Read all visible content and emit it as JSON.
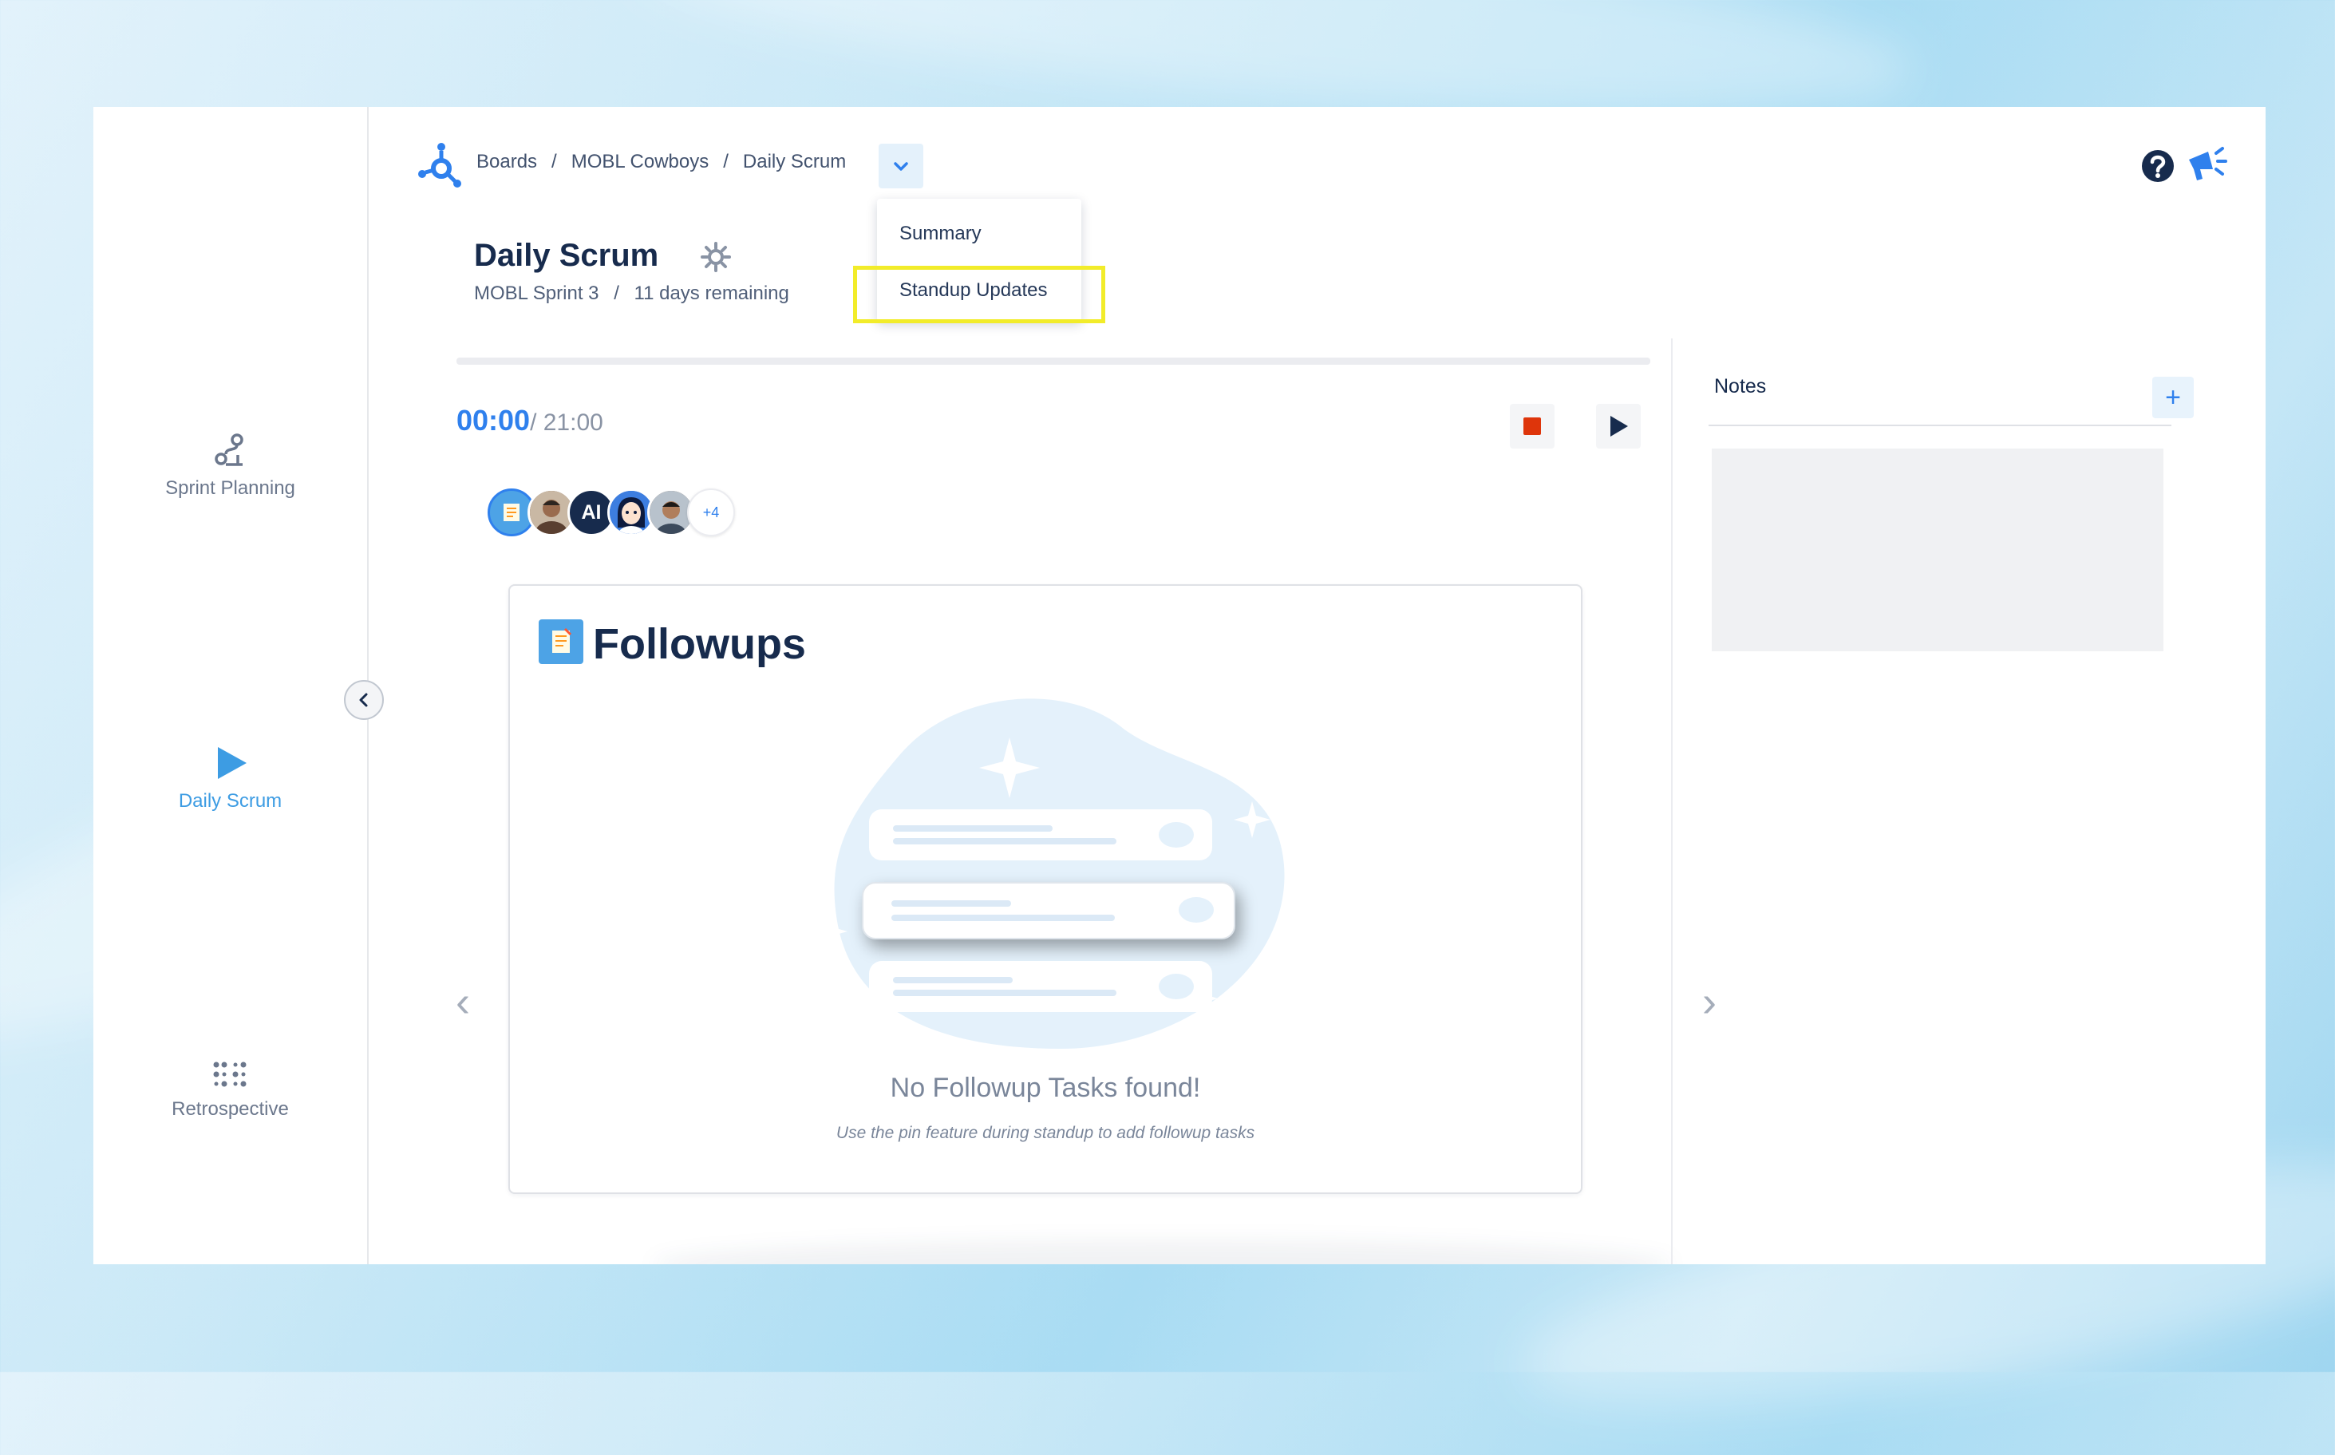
{
  "sidebar": {
    "items": [
      {
        "label": "Sprint Planning",
        "icon": "sprint-planning-icon"
      },
      {
        "label": "Daily Scrum",
        "icon": "play-icon",
        "active": true
      },
      {
        "label": "Retrospective",
        "icon": "retrospective-icon"
      }
    ]
  },
  "header": {
    "breadcrumbs": [
      "Boards",
      "MOBL Cowboys",
      "Daily Scrum"
    ],
    "separator": "/",
    "dropdown_items": [
      "Summary",
      "Standup Updates"
    ],
    "highlighted_item": "Standup Updates"
  },
  "page": {
    "title": "Daily Scrum",
    "sprint": "MOBL Sprint 3",
    "subtitle_separator": "/",
    "remaining": "11 days remaining"
  },
  "timer": {
    "current": "00:00",
    "total": "/ 21:00"
  },
  "avatars": {
    "initials_avatar": "AI",
    "more_count": "+4"
  },
  "followups": {
    "title": "Followups",
    "empty_title": "No Followup Tasks found!",
    "empty_hint": "Use the pin feature during standup to add followup tasks",
    "prev_arrow": "‹",
    "next_arrow": "›"
  },
  "notes": {
    "label": "Notes",
    "add": "+"
  },
  "colors": {
    "accent": "#2f80ed",
    "sidebar_active": "#3d9ce3",
    "stop": "#de350b",
    "highlight": "#f2ec2a"
  }
}
